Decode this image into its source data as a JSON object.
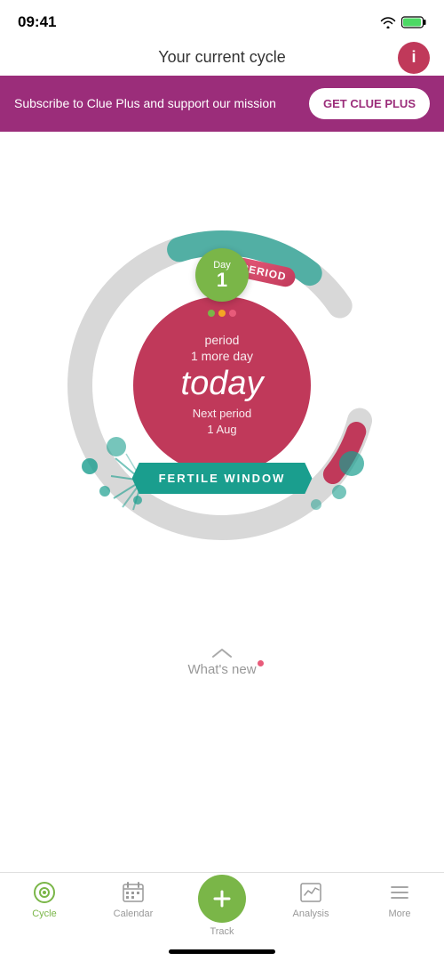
{
  "statusBar": {
    "time": "09:41",
    "wifi": true,
    "battery": "charging"
  },
  "header": {
    "title": "Your current cycle",
    "infoButton": "i"
  },
  "banner": {
    "text": "Subscribe to Clue Plus and support our mission",
    "buttonLabel": "GET CLUE PLUS"
  },
  "cycleWheel": {
    "dayLabel": "Day",
    "dayNumber": "1",
    "periodTag": "PERIOD",
    "centerPeriodLabel": "period",
    "centerMoreDay": "1 more day",
    "centerToday": "today",
    "centerNextLabel": "Next period",
    "centerNextDate": "1 Aug",
    "fertileWindow": "FERTILE WINDOW",
    "dots": [
      {
        "color": "#7ab648"
      },
      {
        "color": "#f4a623"
      },
      {
        "color": "#e85b7a"
      }
    ]
  },
  "whatsNew": {
    "label": "What's new"
  },
  "bottomNav": {
    "items": [
      {
        "id": "cycle",
        "label": "Cycle",
        "active": true
      },
      {
        "id": "calendar",
        "label": "Calendar",
        "active": false
      },
      {
        "id": "track",
        "label": "Track",
        "active": false,
        "isCenter": true
      },
      {
        "id": "analysis",
        "label": "Analysis",
        "active": false
      },
      {
        "id": "more",
        "label": "More",
        "active": false
      }
    ]
  }
}
